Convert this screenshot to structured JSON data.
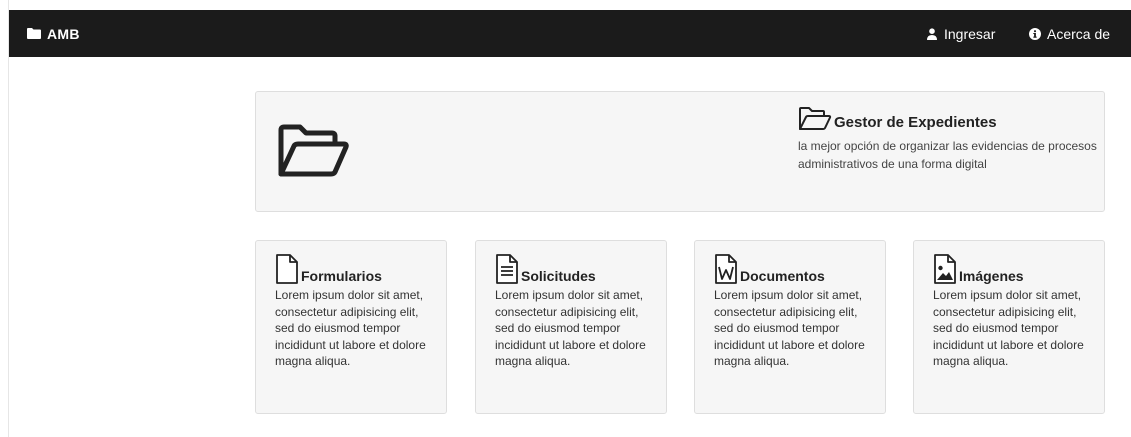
{
  "navbar": {
    "brand": "AMB",
    "links": [
      {
        "label": "Ingresar",
        "icon": "user-icon"
      },
      {
        "label": "Acerca de",
        "icon": "info-circle-icon"
      }
    ],
    "background": "#1b1b1b"
  },
  "hero": {
    "big_icon": "folder-open-icon",
    "title_icon": "folder-open-icon",
    "title": "Gestor de Expedientes",
    "description": "la mejor opción de organizar las evidencias de procesos administrativos de una forma digital"
  },
  "cards": [
    {
      "title": "Formularios",
      "icon": "file-icon",
      "body": "Lorem ipsum dolor sit amet, consectetur adipisicing elit, sed do eiusmod tempor incididunt ut labore et dolore magna aliqua."
    },
    {
      "title": "Solicitudes",
      "icon": "file-text-icon",
      "body": "Lorem ipsum dolor sit amet, consectetur adipisicing elit, sed do eiusmod tempor incididunt ut labore et dolore magna aliqua."
    },
    {
      "title": "Documentos",
      "icon": "file-word-icon",
      "body": "Lorem ipsum dolor sit amet, consectetur adipisicing elit, sed do eiusmod tempor incididunt ut labore et dolore magna aliqua."
    },
    {
      "title": "Imágenes",
      "icon": "file-image-icon",
      "body": "Lorem ipsum dolor sit amet, consectetur adipisicing elit, sed do eiusmod tempor incididunt ut labore et dolore magna aliqua."
    }
  ],
  "colors": {
    "panel_background": "#f6f6f6",
    "panel_border": "#dedede",
    "text": "#333333"
  }
}
